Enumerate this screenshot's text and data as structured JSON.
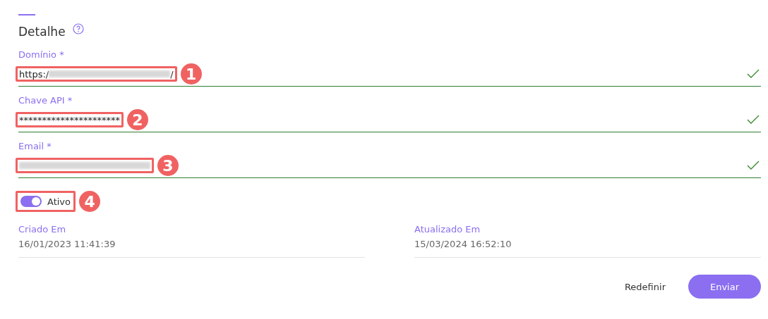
{
  "title": "Detalhe",
  "fields": [
    {
      "label": "Domínio *",
      "value": "https:/",
      "value_end": "/",
      "blurred": true,
      "valid": true,
      "annotation": "1"
    },
    {
      "label": "Chave API *",
      "value": "**********************",
      "valid": true,
      "annotation": "2"
    },
    {
      "label": "Email *",
      "blurred": true,
      "valid": true,
      "annotation": "3"
    }
  ],
  "toggle": {
    "label": "Ativo",
    "on": true,
    "annotation": "4"
  },
  "meta": [
    {
      "label": "Criado Em",
      "value": "16/01/2023 11:41:39"
    },
    {
      "label": "Atualizado Em",
      "value": "15/03/2024 16:52:10"
    }
  ],
  "buttons": [
    {
      "label": "Redefinir",
      "kind": "text"
    },
    {
      "label": "Enviar",
      "kind": "primary"
    }
  ]
}
